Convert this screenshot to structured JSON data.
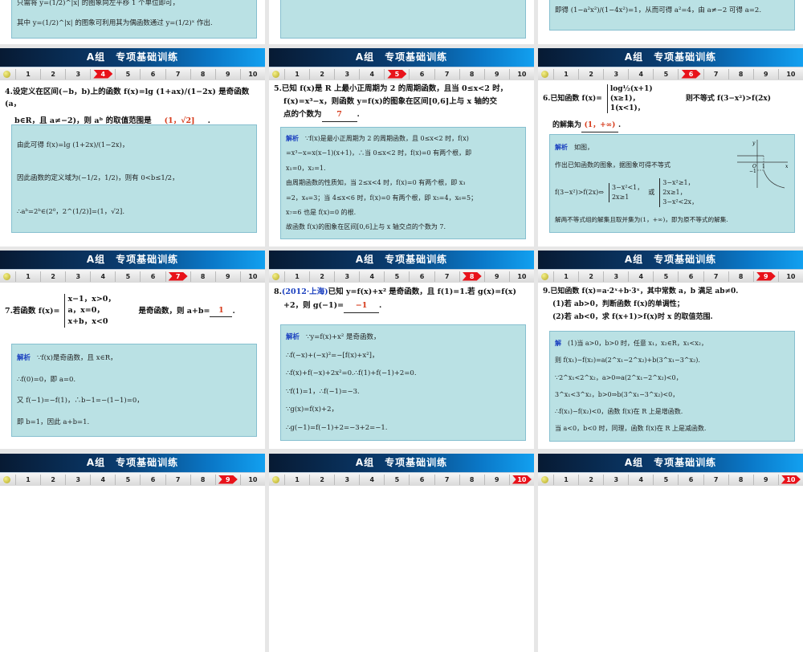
{
  "header_title": "A组　专项基础训练",
  "nav": [
    "1",
    "2",
    "3",
    "4",
    "5",
    "6",
    "7",
    "8",
    "9",
    "10"
  ],
  "partial": {
    "left": [
      "只需将 y=(1/2)^|x| 的图象向左平移 1 个单位即可，",
      "其中 y=(1/2)^|x| 的图象可利用其为偶函数通过 y=(1/2)ˣ 作出."
    ],
    "right": [
      "即得 (1−a²x²)/(1−4x²)=1，从而可得 a²=4，由 a≠−2 可得 a=2."
    ]
  },
  "q4": {
    "l1": "4.设定义在区间(−b，b)上的函数 f(x)=lg (1+ax)/(1−2x) 是奇函数(a，",
    "l2": "b∈R，且 a≠−2)，则 aᵇ 的取值范围是",
    "ans": "(1，√2]",
    "end": ".",
    "sol": [
      "由此可得 f(x)=lg (1+2x)/(1−2x)，",
      "因此函数的定义域为(−1/2，1/2)，则有 0<b≤1/2，",
      "∴aᵇ=2ᵇ∈(2⁰，2^(1/2)]=(1，√2]."
    ]
  },
  "q5": {
    "l1": "5.已知 f(x)是 R 上最小正周期为 2 的周期函数，且当 0≤x<2 时，",
    "l2": "f(x)=x³−x，则函数 y=f(x)的图象在区间[0,6]上与 x 轴的交",
    "l3": "点的个数为",
    "ans": "7",
    "end": ".",
    "label": "解析",
    "sol": [
      "∵f(x)是最小正周期为 2 的周期函数，且 0≤x<2 时，f(x)",
      "=x³−x=x(x−1)(x+1)，∴当 0≤x<2 时，f(x)=0 有两个根，即",
      "x₁=0，x₂=1.",
      "由周期函数的性质知，当 2≤x<4 时，f(x)=0 有两个根，即 x₃",
      "=2，x₄=3；当 4≤x<6 时，f(x)=0 有两个根，即 x₅=4，x₆=5；",
      "x₇=6 也是 f(x)=0 的根.",
      "故函数 f(x)的图象在区间[0,6]上与 x 轴交点的个数为 7."
    ]
  },
  "q6": {
    "pre": "6.已知函数 f(x)=",
    "piece": [
      "log½(x+1)(x≥1)，",
      "1(x<1)，"
    ],
    "post": "则不等式 f(3−x²)>f(2x)",
    "l2": "的解集为",
    "ans": "(1，+∞)",
    "end": ".",
    "label": "解析",
    "s1": "如图，",
    "s2": "作出已知函数的图象，据图象可得不等式",
    "s3": "f(3−x²)>f(2x)⇔",
    "p1": [
      "3−x²<1，",
      "2x≥1"
    ],
    "or": "或",
    "p2": [
      "3−x²≥1，",
      "2x≥1，",
      "3−x²<2x，"
    ],
    "s4": "解两不等式组的解集且取并集为(1，+∞)，即为原不等式的解集.",
    "graph": {
      "y": "y",
      "o": "O",
      "one": "1",
      "x": "x",
      "neg1": "−1"
    }
  },
  "q7": {
    "pre": "7.若函数 f(x)=",
    "piece": [
      "x−1，x>0，",
      "a，x=0，",
      "x+b，x<0"
    ],
    "post": "是奇函数，则 a+b=",
    "ans": "1",
    "end": ".",
    "label": "解析",
    "sol": [
      "∵f(x)是奇函数，且 x∈R，",
      "∴f(0)=0，即 a=0.",
      "又 f(−1)=−f(1)，∴b−1=−(1−1)=0，",
      "即 b=1，因此 a+b=1."
    ]
  },
  "q8": {
    "num": "8.",
    "src": "(2012·上海)",
    "l1": "已知 y=f(x)+x² 是奇函数，且 f(1)=1.若 g(x)=f(x)",
    "l2": "+2，则 g(−1)=",
    "ans": "−1",
    "end": ".",
    "label": "解析",
    "sol": [
      "∵y=f(x)+x² 是奇函数，",
      "∴f(−x)+(−x)²=−[f(x)+x²]，",
      "∴f(x)+f(−x)+2x²=0.∴f(1)+f(−1)+2=0.",
      "∵f(1)=1，∴f(−1)=−3.",
      "∵g(x)=f(x)+2，",
      "∴g(−1)=f(−1)+2=−3+2=−1."
    ]
  },
  "q9": {
    "l1": "9.已知函数 f(x)=a·2ˣ+b·3ˣ，其中常数 a，b 满足 ab≠0.",
    "l2": "(1)若 ab>0，判断函数 f(x)的单调性；",
    "l3": "(2)若 ab<0，求 f(x+1)>f(x)时 x 的取值范围.",
    "label": "解",
    "s0": "(1)当 a>0，b>0 时，任意 x₁，x₂∈R，x₁<x₂，",
    "sol": [
      "则 f(x₁)−f(x₂)=a(2^x₁−2^x₂)+b(3^x₁−3^x₂).",
      "∵2^x₁<2^x₂，a>0⇒a(2^x₁−2^x₂)<0，",
      "3^x₁<3^x₂，b>0⇒b(3^x₁−3^x₂)<0，",
      "∴f(x₁)−f(x₂)<0，函数 f(x)在 R 上是增函数.",
      "当 a<0，b<0 时，同理，函数 f(x)在 R 上是减函数."
    ]
  },
  "active": {
    "r1": [
      4,
      5,
      6
    ],
    "r2": [
      7,
      8,
      9
    ],
    "r3": [
      9,
      10,
      10
    ]
  }
}
